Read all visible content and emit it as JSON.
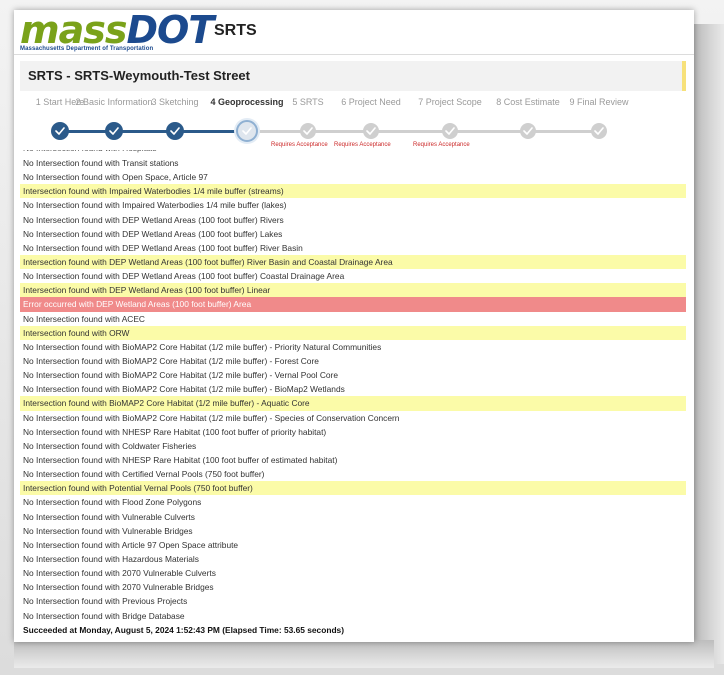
{
  "header": {
    "logo": {
      "text_main": "mass",
      "text_accent": "DOT",
      "subtitle": "Massachusetts Department of Transportation"
    },
    "app_title": "SRTS"
  },
  "page": {
    "title": "SRTS - SRTS-Weymouth-Test Street"
  },
  "stepper": {
    "steps": [
      {
        "label": "1 Start Here",
        "state": "done"
      },
      {
        "label": "2 Basic Information",
        "state": "done"
      },
      {
        "label": "3 Sketching",
        "state": "done"
      },
      {
        "label": "4 Geoprocessing",
        "state": "current"
      },
      {
        "label": "5 SRTS",
        "state": "todo",
        "note": "Requires Acceptance"
      },
      {
        "label": "6 Project Need",
        "state": "todo",
        "note": "Requires Acceptance"
      },
      {
        "label": "7 Project Scope",
        "state": "todo",
        "note": "Requires Acceptance"
      },
      {
        "label": "8 Cost Estimate",
        "state": "todo"
      },
      {
        "label": "9 Final Review",
        "state": "todo"
      }
    ],
    "colors": {
      "done": "#2b5a8a",
      "todo": "#cfcfcf",
      "line_done": "#2b5a8a",
      "line_todo": "#cfcfcf"
    }
  },
  "log": {
    "partial_line": "No Intersection found with Hospitals",
    "rows": [
      {
        "text": "No Intersection found with Transit stations",
        "status": "none"
      },
      {
        "text": "No Intersection found with Open Space, Article 97",
        "status": "none"
      },
      {
        "text": "Intersection found with Impaired Waterbodies 1/4 mile buffer (streams)",
        "status": "hit"
      },
      {
        "text": "No Intersection found with Impaired Waterbodies 1/4 mile buffer (lakes)",
        "status": "none"
      },
      {
        "text": "No Intersection found with DEP Wetland Areas (100 foot buffer) Rivers",
        "status": "none"
      },
      {
        "text": "No Intersection found with DEP Wetland Areas (100 foot buffer) Lakes",
        "status": "none"
      },
      {
        "text": "No Intersection found with DEP Wetland Areas (100 foot buffer) River Basin",
        "status": "none"
      },
      {
        "text": "Intersection found with DEP Wetland Areas (100 foot buffer) River Basin and Coastal Drainage Area",
        "status": "hit"
      },
      {
        "text": "No Intersection found with DEP Wetland Areas (100 foot buffer) Coastal Drainage Area",
        "status": "none"
      },
      {
        "text": "Intersection found with DEP Wetland Areas (100 foot buffer) Linear",
        "status": "hit"
      },
      {
        "text": "Error occurred with DEP Wetland Areas (100 foot buffer) Area",
        "status": "error"
      },
      {
        "text": "No Intersection found with ACEC",
        "status": "none"
      },
      {
        "text": "Intersection found with ORW",
        "status": "hit"
      },
      {
        "text": "No Intersection found with BioMAP2 Core Habitat (1/2 mile buffer) - Priority Natural Communities",
        "status": "none"
      },
      {
        "text": "No Intersection found with BioMAP2 Core Habitat (1/2 mile buffer) - Forest Core",
        "status": "none"
      },
      {
        "text": "No Intersection found with BioMAP2 Core Habitat (1/2 mile buffer) - Vernal Pool Core",
        "status": "none"
      },
      {
        "text": "No Intersection found with BioMAP2 Core Habitat (1/2 mile buffer) - BioMap2 Wetlands",
        "status": "none"
      },
      {
        "text": "Intersection found with BioMAP2 Core Habitat (1/2 mile buffer) - Aquatic Core",
        "status": "hit"
      },
      {
        "text": "No Intersection found with BioMAP2 Core Habitat (1/2 mile buffer) - Species of Conservation Concern",
        "status": "none"
      },
      {
        "text": "No Intersection found with NHESP Rare Habitat (100 foot buffer of priority habitat)",
        "status": "none"
      },
      {
        "text": "No Intersection found with Coldwater Fisheries",
        "status": "none"
      },
      {
        "text": "No Intersection found with NHESP Rare Habitat (100 foot buffer of estimated habitat)",
        "status": "none"
      },
      {
        "text": "No Intersection found with Certified Vernal Pools (750 foot buffer)",
        "status": "none"
      },
      {
        "text": "Intersection found with Potential Vernal Pools (750 foot buffer)",
        "status": "hit"
      },
      {
        "text": "No Intersection found with Flood Zone Polygons",
        "status": "none"
      },
      {
        "text": "No Intersection found with Vulnerable Culverts",
        "status": "none"
      },
      {
        "text": "No Intersection found with Vulnerable Bridges",
        "status": "none"
      },
      {
        "text": "No Intersection found with Article 97 Open Space attribute",
        "status": "none"
      },
      {
        "text": "No Intersection found with Hazardous Materials",
        "status": "none"
      },
      {
        "text": "No Intersection found with 2070 Vulnerable Culverts",
        "status": "none"
      },
      {
        "text": "No Intersection found with 2070 Vulnerable Bridges",
        "status": "none"
      },
      {
        "text": "No Intersection found with Previous Projects",
        "status": "none"
      },
      {
        "text": "No Intersection found with Bridge Database",
        "status": "none"
      }
    ],
    "summary": "Succeeded at Monday, August 5, 2024 1:52:43 PM (Elapsed Time: 53.65 seconds)",
    "colors": {
      "hit": "#fbfba8",
      "error": "#f08a8a"
    }
  }
}
